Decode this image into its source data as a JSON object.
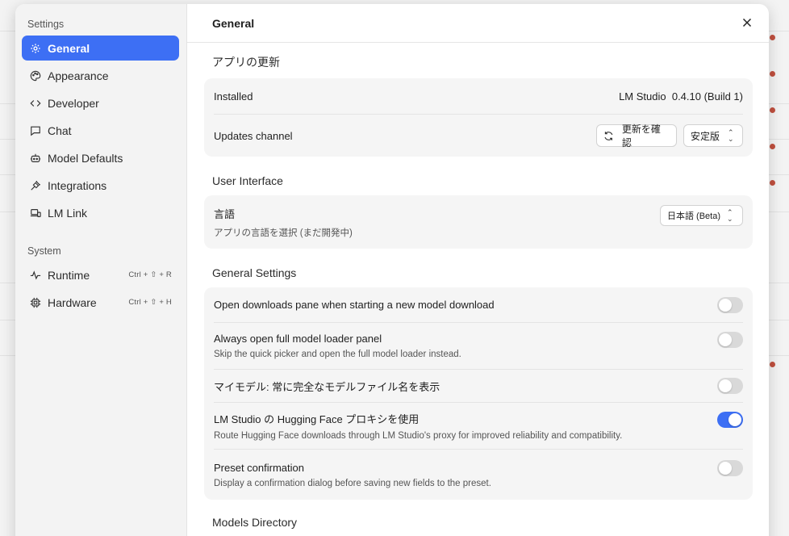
{
  "sidebar": {
    "section_settings": "Settings",
    "items": [
      {
        "label": "General",
        "icon": "gear-icon"
      },
      {
        "label": "Appearance",
        "icon": "palette-icon"
      },
      {
        "label": "Developer",
        "icon": "code-icon"
      },
      {
        "label": "Chat",
        "icon": "chat-icon"
      },
      {
        "label": "Model Defaults",
        "icon": "robot-icon"
      },
      {
        "label": "Integrations",
        "icon": "plug-icon"
      },
      {
        "label": "LM Link",
        "icon": "link-icon"
      }
    ],
    "section_system": "System",
    "system_items": [
      {
        "label": "Runtime",
        "icon": "pulse-icon",
        "shortcut": "Ctrl + ⇧ + R"
      },
      {
        "label": "Hardware",
        "icon": "chip-icon",
        "shortcut": "Ctrl + ⇧ + H"
      }
    ]
  },
  "header": {
    "title": "General"
  },
  "app_update": {
    "title": "アプリの更新",
    "installed_label": "Installed",
    "installed_value": "LM Studio  0.4.10 (Build 1)",
    "channel_label": "Updates channel",
    "check_button": "更新を確認",
    "channel_select": "安定版"
  },
  "ui": {
    "title": "User Interface",
    "language_label": "言語",
    "language_sub": "アプリの言語を選択 (まだ開発中)",
    "language_select": "日本語 (Beta)"
  },
  "general": {
    "title": "General Settings",
    "settings": [
      {
        "label": "Open downloads pane when starting a new model download",
        "sub": "",
        "on": false
      },
      {
        "label": "Always open full model loader panel",
        "sub": "Skip the quick picker and open the full model loader instead.",
        "on": false
      },
      {
        "label": "マイモデル: 常に完全なモデルファイル名を表示",
        "sub": "",
        "on": false
      },
      {
        "label": "LM Studio の Hugging Face プロキシを使用",
        "sub": "Route Hugging Face downloads through LM Studio's proxy for improved reliability and compatibility.",
        "on": true
      },
      {
        "label": "Preset confirmation",
        "sub": "Display a confirmation dialog before saving new fields to the preset.",
        "on": false
      }
    ]
  },
  "models_dir": {
    "title": "Models Directory"
  },
  "colors": {
    "accent": "#3d6ff4",
    "toggle_off": "#d9d9d9"
  }
}
